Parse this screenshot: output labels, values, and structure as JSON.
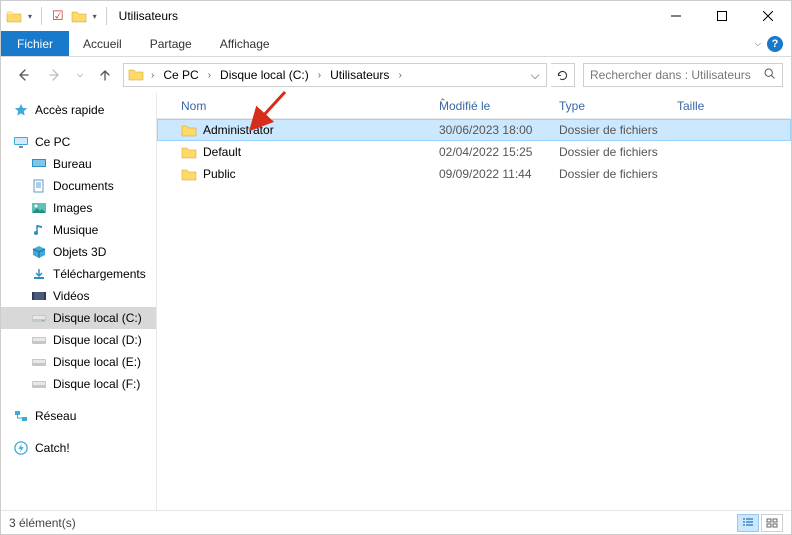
{
  "window": {
    "title": "Utilisateurs"
  },
  "ribbon": {
    "file": "Fichier",
    "tabs": [
      "Accueil",
      "Partage",
      "Affichage"
    ]
  },
  "breadcrumb": {
    "items": [
      "Ce PC",
      "Disque local (C:)",
      "Utilisateurs"
    ]
  },
  "search": {
    "placeholder": "Rechercher dans : Utilisateurs"
  },
  "tree": {
    "quick": "Accès rapide",
    "thispc": "Ce PC",
    "thispc_children": [
      "Bureau",
      "Documents",
      "Images",
      "Musique",
      "Objets 3D",
      "Téléchargements",
      "Vidéos",
      "Disque local (C:)",
      "Disque local (D:)",
      "Disque local (E:)",
      "Disque local (F:)"
    ],
    "network": "Réseau",
    "catch": "Catch!"
  },
  "columns": {
    "name": "Nom",
    "modified": "Modifié le",
    "type": "Type",
    "size": "Taille"
  },
  "rows": [
    {
      "name": "Administrator",
      "modified": "30/06/2023 18:00",
      "type": "Dossier de fichiers",
      "selected": true
    },
    {
      "name": "Default",
      "modified": "02/04/2022 15:25",
      "type": "Dossier de fichiers",
      "selected": false
    },
    {
      "name": "Public",
      "modified": "09/09/2022 11:44",
      "type": "Dossier de fichiers",
      "selected": false
    }
  ],
  "status": {
    "count": "3 élément(s)"
  }
}
